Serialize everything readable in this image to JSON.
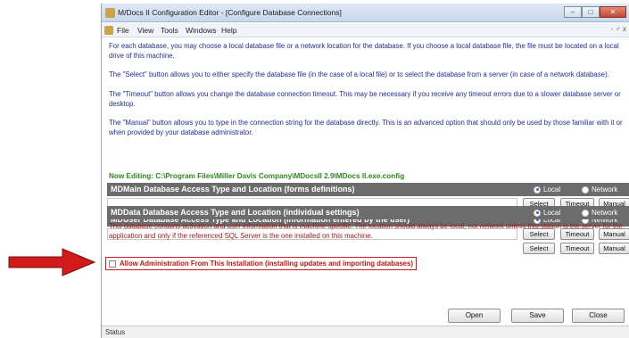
{
  "window": {
    "title": "M/Docs II Configuration Editor - [Configure Database Connections]",
    "controls": {
      "minimize": "–",
      "maximize": "□",
      "close": "✕"
    }
  },
  "menu": {
    "items": [
      "File",
      "View",
      "Tools",
      "Windows",
      "Help"
    ],
    "right": "- ♂ x"
  },
  "instructions": [
    "For each database, you may choose a local database file or a network location for the database. If you choose a local database file, the file must be located on a local drive of this machine.",
    "The \"Select\" button allows you to either specify the database file (in the case of a local file) or to select the database from a server (in case of a network database).",
    "The \"Timeout\" button allows you change the database connection timeout.  This may be necessary if you receive any timeout errors due to a slower database server or desktop.",
    "The \"Manual\" button allows you to type in the connection string for the database directly.  This is an advanced option that should only be used by those familiar with it or when provided by your database administrator."
  ],
  "now_editing": "Now Editing: C:\\Program Files\\Miller Davis Company\\MDocsII 2.9\\MDocs II.exe.config",
  "radio_labels": {
    "local": "Local",
    "network": "Network"
  },
  "button_labels": {
    "select": "Select",
    "timeout": "Timeout",
    "manual": "Manual"
  },
  "sections": [
    {
      "title": "MDMain Database Access Type and Location (forms definitions)",
      "selected": "local",
      "value": ""
    },
    {
      "title": "MDUser Database Access Type and Location (information entered by the user)",
      "selected": "local",
      "value": ""
    },
    {
      "title": "MDData Database Access Type and Location (individual settings)",
      "selected": "local",
      "value": "",
      "description": "This database contains activation and user information that is machine specific. The location should always be local, not network unless this station is the server for the application and only if the referenced SQL Server is the one installed on this machine."
    }
  ],
  "allow_admin": {
    "label": "Allow Administration From This Installation (installing updates and importing databases)",
    "checked": false
  },
  "footer_buttons": {
    "open": "Open",
    "save": "Save",
    "close": "Close"
  },
  "status": "Status",
  "colors": {
    "annotation": "#d11a1a",
    "section_header": "#6c6c6c",
    "instruction_text": "#1f2f98",
    "now_editing": "#2e8b1e"
  }
}
